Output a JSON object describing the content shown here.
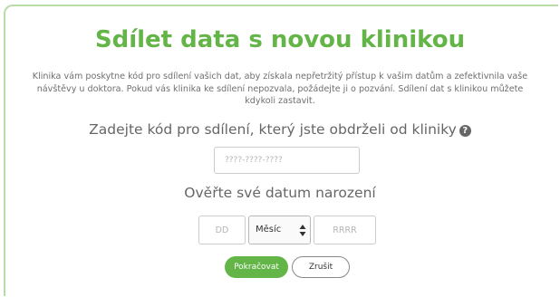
{
  "dialog": {
    "title": "Sdílet data s novou klinikou",
    "description": "Klinika vám poskytne kód pro sdílení vašich dat, aby získala nepřetržitý přístup k vašim datům a zefektivnila vaše návštěvy u doktora. Pokud vás klinika ke sdílení nepozvala, požádejte ji o pozvání. Sdílení dat s klinikou můžete kdykoli zastavit.",
    "code_label": "Zadejte kód pro sdílení, který jste obdrželi od kliniky",
    "help_icon_glyph": "?",
    "code_placeholder": "????-????-????",
    "dob_label": "Ověřte své datum narození",
    "dob": {
      "day_placeholder": "DD",
      "month_value": "Měsíc",
      "year_placeholder": "RRRR"
    },
    "buttons": {
      "continue_label": "Pokračovat",
      "cancel_label": "Zrušit"
    }
  },
  "colors": {
    "accent": "#63b548",
    "frame_border": "#b9dca6",
    "text_muted": "#6f6f6f",
    "text_label": "#666666"
  },
  "icons": {
    "help": "help-circle-icon",
    "select_arrows": "select-arrows-icon"
  }
}
